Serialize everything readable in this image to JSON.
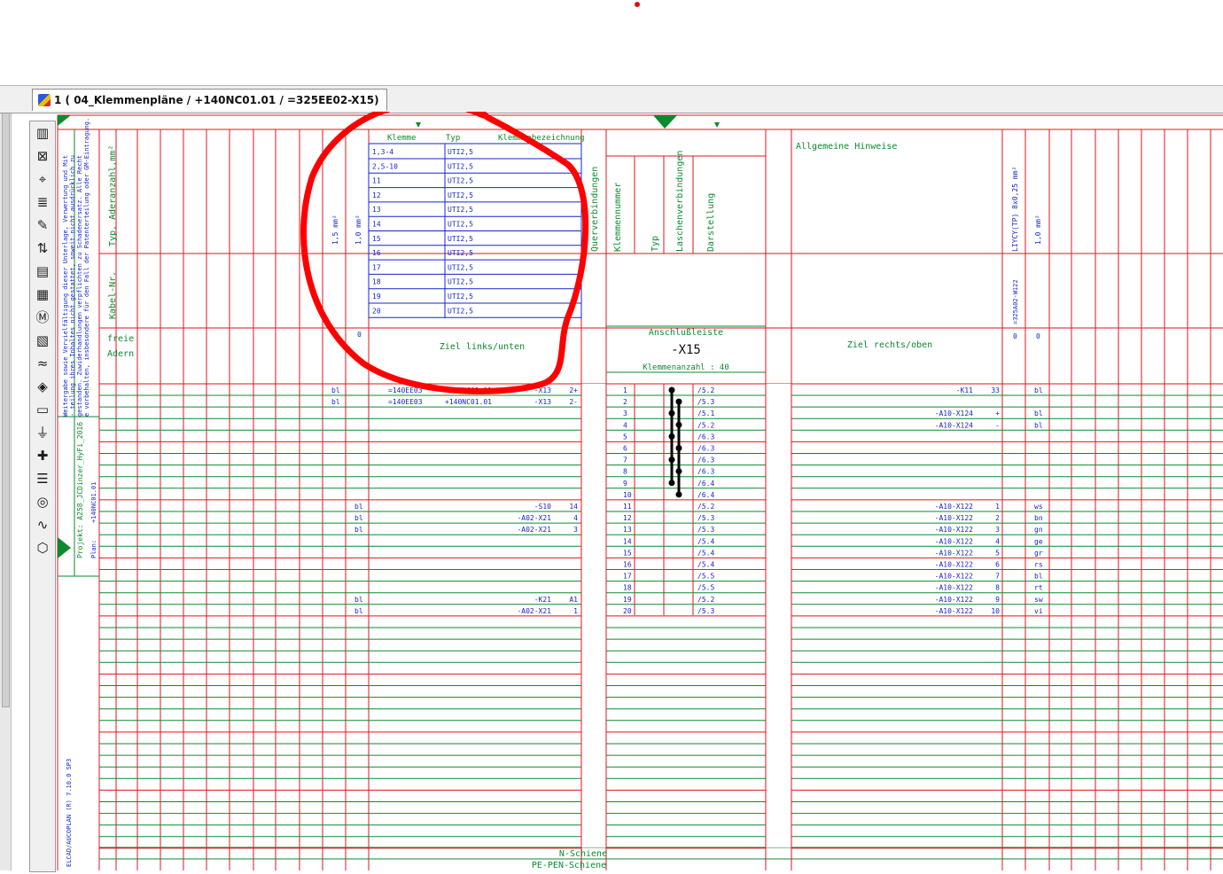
{
  "window": {
    "tab_title": "1 ( 04_Klemmenpläne  / +140NC01.01  / =325EE02-X15)"
  },
  "toolbar": {
    "tools": [
      {
        "name": "terminal-strip-tool",
        "glyph": "▥"
      },
      {
        "name": "cross-box-tool",
        "glyph": "⊠"
      },
      {
        "name": "connection-point-tool",
        "glyph": "⌖"
      },
      {
        "name": "multi-line-tool",
        "glyph": "≣"
      },
      {
        "name": "device-edit-tool",
        "glyph": "✎"
      },
      {
        "name": "jumper-tool",
        "glyph": "⇅"
      },
      {
        "name": "plc-card-tool",
        "glyph": "▤"
      },
      {
        "name": "terminal-block-tool",
        "glyph": "▦"
      },
      {
        "name": "motor-tool",
        "glyph": "Ⓜ"
      },
      {
        "name": "connector-row-tool",
        "glyph": "▧"
      },
      {
        "name": "coil-tool",
        "glyph": "≈"
      },
      {
        "name": "diamond-tool",
        "glyph": "◈"
      },
      {
        "name": "fuse-tool",
        "glyph": "▭"
      },
      {
        "name": "diode-tool",
        "glyph": "⏚"
      },
      {
        "name": "cross-tool",
        "glyph": "✚"
      },
      {
        "name": "bus-bar-tool",
        "glyph": "☰"
      },
      {
        "name": "gauge-tool",
        "glyph": "◎"
      },
      {
        "name": "spring-tool",
        "glyph": "∿"
      },
      {
        "name": "hexagon-tool",
        "glyph": "⬡"
      }
    ]
  },
  "colors": {
    "grid_red": "#e0141e",
    "grid_green": "#0c8a2e",
    "text_blue": "#1626c8",
    "text_green": "#0c8a2e",
    "annotation_red": "#ff0000"
  },
  "left_header": {
    "rotated_header_1": "Typ, Aderanzahl,mm²",
    "rotated_header_2": "Kabel-Nr.",
    "freie": "freie",
    "adern": "Adern"
  },
  "side_notes": {
    "copyright": "Weitergabe sowie Vervielfältigung dieser Unterlage, Verwertung und Mit- teilung ihres Inhaltes nicht gestattet, soweit nicht ausdrücklich zugestanden. Zuwiderhandlungen verpflichten zu Schadenersatz. Alle Rechte vorbehalten, insbesondere für den Fall der Patenterteilung oder GM-Eintragung.",
    "projekt": "Projekt: A258_JCDinzer_HyFi_2016",
    "plan_label": "Plan:",
    "plan_value": "+140NC01.01",
    "software": "ELCAD/AUCOPLAN (R) 7.10.0 SP3"
  },
  "col_headers": {
    "cross_1": "1,5 mm²",
    "cross_2": "1,0 mm²",
    "mark_1": "0",
    "mark_2": "0"
  },
  "terminal_table": {
    "headers": [
      "Klemme",
      "Typ",
      "Klemmenbezeichnung"
    ],
    "rows": [
      [
        "1,3-4",
        "UTI2,5"
      ],
      [
        "2,5-10",
        "UTI2,5"
      ],
      [
        "11",
        "UTI2,5"
      ],
      [
        "12",
        "UTI2,5"
      ],
      [
        "13",
        "UTI2,5"
      ],
      [
        "14",
        "UTI2,5"
      ],
      [
        "15",
        "UTI2,5"
      ],
      [
        "16",
        "UTI2,5"
      ],
      [
        "17",
        "UTI2,5"
      ],
      [
        "18",
        "UTI2,5"
      ],
      [
        "19",
        "UTI2,5"
      ],
      [
        "20",
        "UTI2,5"
      ]
    ]
  },
  "ziel_links": "Ziel links/unten",
  "ziel_rechts": "Ziel rechts/oben",
  "allgemeine_hinweise": "Allgemeine Hinweise",
  "middle_headers": [
    "Querverbindungen",
    "Klemmennummer",
    "Typ",
    "Laschenverbindungen",
    "Darstellung"
  ],
  "strip": {
    "title": "Anschlußleiste",
    "name": "-X15",
    "count": "Klemmenanzahl : 40"
  },
  "right_headers": {
    "cable_type": "LIYCY(TP) 8x0,25 mm²",
    "cable_no": "=325A02-W122",
    "cross": "1,0 mm²",
    "mark_1": "0",
    "mark_2": "0"
  },
  "rows": [
    {
      "color_l": "bl",
      "col15": "",
      "ziel_a": "=140EE03",
      "ziel_b": "+140NC01.01",
      "ziel_c": "-X13",
      "ziel_d": "2+",
      "nr": "1",
      "ref": "/5.2",
      "rdev": "-K11",
      "rpin": "33",
      "rcol": "bl"
    },
    {
      "color_l": "bl",
      "col15": "",
      "ziel_a": "=140EE03",
      "ziel_b": "+140NC01.01",
      "ziel_c": "-X13",
      "ziel_d": "2-",
      "nr": "2",
      "ref": "/5.3",
      "rdev": "",
      "rpin": "",
      "rcol": ""
    },
    {
      "color_l": "",
      "col15": "",
      "ziel_a": "",
      "ziel_b": "",
      "ziel_c": "",
      "ziel_d": "",
      "nr": "3",
      "ref": "/5.1",
      "rdev": "-A10-X124",
      "rpin": "+",
      "rcol": "bl"
    },
    {
      "color_l": "",
      "col15": "",
      "ziel_a": "",
      "ziel_b": "",
      "ziel_c": "",
      "ziel_d": "",
      "nr": "4",
      "ref": "/5.2",
      "rdev": "-A10-X124",
      "rpin": "-",
      "rcol": "bl"
    },
    {
      "color_l": "",
      "col15": "",
      "ziel_a": "",
      "ziel_b": "",
      "ziel_c": "",
      "ziel_d": "",
      "nr": "5",
      "ref": "/6.3",
      "rdev": "",
      "rpin": "",
      "rcol": ""
    },
    {
      "color_l": "",
      "col15": "",
      "ziel_a": "",
      "ziel_b": "",
      "ziel_c": "",
      "ziel_d": "",
      "nr": "6",
      "ref": "/6.3",
      "rdev": "",
      "rpin": "",
      "rcol": ""
    },
    {
      "color_l": "",
      "col15": "",
      "ziel_a": "",
      "ziel_b": "",
      "ziel_c": "",
      "ziel_d": "",
      "nr": "7",
      "ref": "/6.3",
      "rdev": "",
      "rpin": "",
      "rcol": ""
    },
    {
      "color_l": "",
      "col15": "",
      "ziel_a": "",
      "ziel_b": "",
      "ziel_c": "",
      "ziel_d": "",
      "nr": "8",
      "ref": "/6.3",
      "rdev": "",
      "rpin": "",
      "rcol": ""
    },
    {
      "color_l": "",
      "col15": "",
      "ziel_a": "",
      "ziel_b": "",
      "ziel_c": "",
      "ziel_d": "",
      "nr": "9",
      "ref": "/6.4",
      "rdev": "",
      "rpin": "",
      "rcol": ""
    },
    {
      "color_l": "",
      "col15": "",
      "ziel_a": "",
      "ziel_b": "",
      "ziel_c": "",
      "ziel_d": "",
      "nr": "10",
      "ref": "/6.4",
      "rdev": "",
      "rpin": "",
      "rcol": ""
    },
    {
      "color_l": "",
      "col15": "bl",
      "ziel_a": "",
      "ziel_b": "",
      "ziel_c": "-S10",
      "ziel_d": "14",
      "nr": "11",
      "ref": "/5.2",
      "rdev": "-A10-X122",
      "rpin": "1",
      "rcol": "ws"
    },
    {
      "color_l": "",
      "col15": "bl",
      "ziel_a": "",
      "ziel_b": "",
      "ziel_c": "-A02-X21",
      "ziel_d": "4",
      "nr": "12",
      "ref": "/5.3",
      "rdev": "-A10-X122",
      "rpin": "2",
      "rcol": "bn"
    },
    {
      "color_l": "",
      "col15": "bl",
      "ziel_a": "",
      "ziel_b": "",
      "ziel_c": "-A02-X21",
      "ziel_d": "3",
      "nr": "13",
      "ref": "/5.3",
      "rdev": "-A10-X122",
      "rpin": "3",
      "rcol": "gn"
    },
    {
      "color_l": "",
      "col15": "",
      "ziel_a": "",
      "ziel_b": "",
      "ziel_c": "",
      "ziel_d": "",
      "nr": "14",
      "ref": "/5.4",
      "rdev": "-A10-X122",
      "rpin": "4",
      "rcol": "ge"
    },
    {
      "color_l": "",
      "col15": "",
      "ziel_a": "",
      "ziel_b": "",
      "ziel_c": "",
      "ziel_d": "",
      "nr": "15",
      "ref": "/5.4",
      "rdev": "-A10-X122",
      "rpin": "5",
      "rcol": "gr"
    },
    {
      "color_l": "",
      "col15": "",
      "ziel_a": "",
      "ziel_b": "",
      "ziel_c": "",
      "ziel_d": "",
      "nr": "16",
      "ref": "/5.4",
      "rdev": "-A10-X122",
      "rpin": "6",
      "rcol": "rs"
    },
    {
      "color_l": "",
      "col15": "",
      "ziel_a": "",
      "ziel_b": "",
      "ziel_c": "",
      "ziel_d": "",
      "nr": "17",
      "ref": "/5.5",
      "rdev": "-A10-X122",
      "rpin": "7",
      "rcol": "bl"
    },
    {
      "color_l": "",
      "col15": "",
      "ziel_a": "",
      "ziel_b": "",
      "ziel_c": "",
      "ziel_d": "",
      "nr": "18",
      "ref": "/5.5",
      "rdev": "-A10-X122",
      "rpin": "8",
      "rcol": "rt"
    },
    {
      "color_l": "",
      "col15": "bl",
      "ziel_a": "",
      "ziel_b": "",
      "ziel_c": "-K21",
      "ziel_d": "A1",
      "nr": "19",
      "ref": "/5.2",
      "rdev": "-A10-X122",
      "rpin": "9",
      "rcol": "sw"
    },
    {
      "color_l": "",
      "col15": "bl",
      "ziel_a": "",
      "ziel_b": "",
      "ziel_c": "-A02-X21",
      "ziel_d": "1",
      "nr": "20",
      "ref": "/5.3",
      "rdev": "-A10-X122",
      "rpin": "10",
      "rcol": "vi"
    }
  ],
  "footer": {
    "n_schiene": "N-Schiene",
    "pe_schiene": "PE-PEN-Schiene"
  }
}
